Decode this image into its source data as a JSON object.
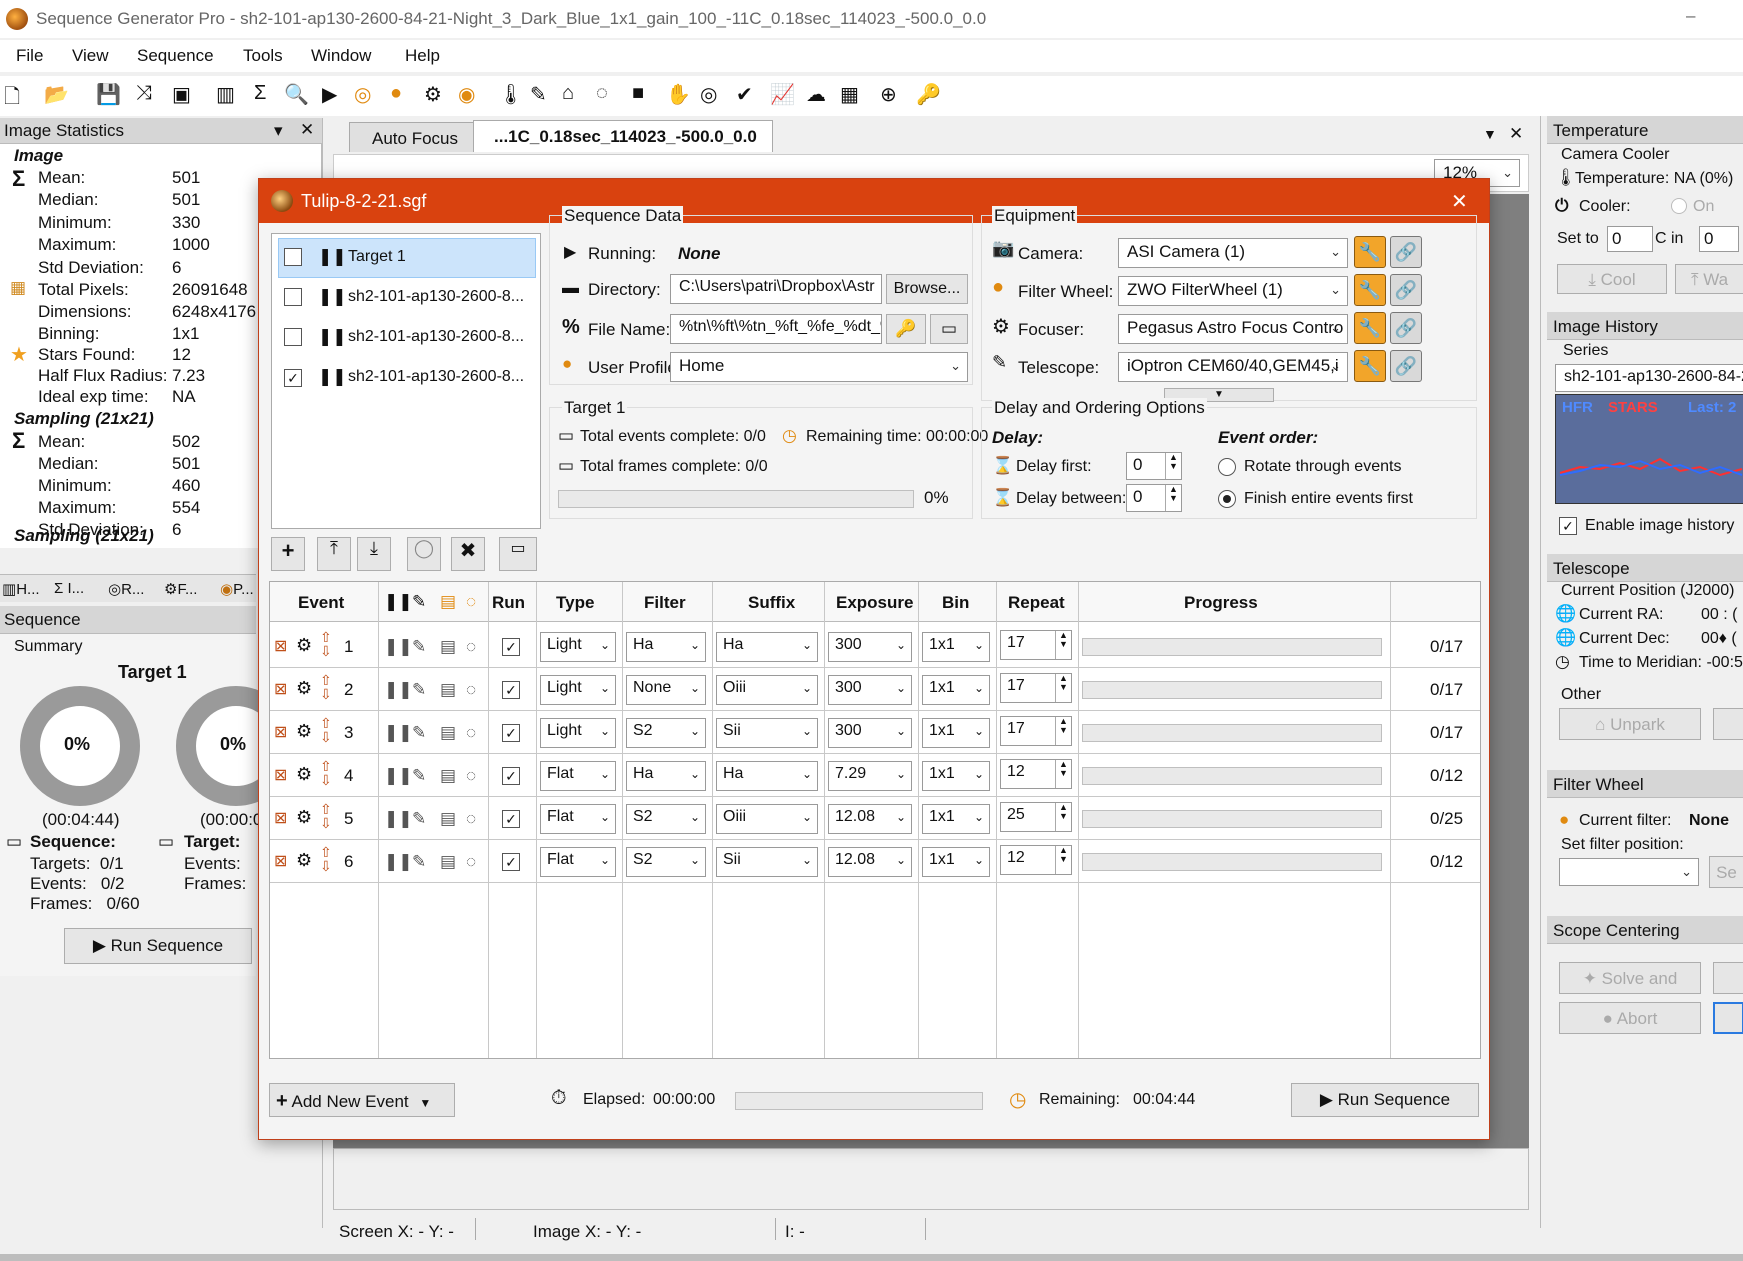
{
  "app": {
    "title": "Sequence Generator Pro - sh2-101-ap130-2600-84-21-Night_3_Dark_Blue_1x1_gain_100_-11C_0.18sec_114023_-500.0_0.0",
    "minimize": "–"
  },
  "menu": [
    "File",
    "View",
    "Sequence",
    "Tools",
    "Window",
    "Help"
  ],
  "stats": {
    "panel_title": "Image Statistics",
    "image_heading": "Image",
    "rows": [
      {
        "label": "Mean:",
        "value": "501"
      },
      {
        "label": "Median:",
        "value": "501"
      },
      {
        "label": "Minimum:",
        "value": "330"
      },
      {
        "label": "Maximum:",
        "value": "1000"
      },
      {
        "label": "Std Deviation:",
        "value": "6"
      },
      {
        "label": "Total Pixels:",
        "value": "26091648"
      },
      {
        "label": "Dimensions:",
        "value": "6248x4176"
      },
      {
        "label": "Binning:",
        "value": "1x1"
      },
      {
        "label": "Stars Found:",
        "value": "12"
      },
      {
        "label": "Half Flux Radius:",
        "value": "7.23"
      },
      {
        "label": "Ideal exp time:",
        "value": "NA"
      }
    ],
    "sampling_heading": "Sampling (21x21)",
    "sampling_rows": [
      {
        "label": "Mean:",
        "value": "502"
      },
      {
        "label": "Median:",
        "value": "501"
      },
      {
        "label": "Minimum:",
        "value": "460"
      },
      {
        "label": "Maximum:",
        "value": "554"
      },
      {
        "label": "Std Deviation:",
        "value": "6"
      }
    ],
    "tabs": [
      "H...",
      "I...",
      "R...",
      "F...",
      "P..."
    ]
  },
  "seqpanel": {
    "title": "Sequence",
    "summary": "Summary",
    "target_title": "Target 1",
    "ring1": "0%",
    "ring2": "0%",
    "time1": "(00:04:44)",
    "time2": "(00:00:0",
    "seq_label": "Sequence:",
    "target_label": "Target:",
    "targets": "Targets:  0/1",
    "events": "Events:   0/2",
    "frames": "Frames:   0/60",
    "t_events": "Events:",
    "t_frames": "Frames:",
    "run": "Run Sequence"
  },
  "doctabs": {
    "autofocus": "Auto Focus",
    "image": "...1C_0.18sec_114023_-500.0_0.0",
    "zoom": "12%"
  },
  "status": {
    "screen": "Screen X: - Y: -",
    "image": "Image X: - Y: -",
    "i": "I: -"
  },
  "dialog": {
    "title": "Tulip-8-2-21.sgf",
    "close": "✕",
    "targets": [
      {
        "name": "Target 1",
        "checked": false
      },
      {
        "name": "sh2-101-ap130-2600-8...",
        "checked": false
      },
      {
        "name": "sh2-101-ap130-2600-8...",
        "checked": false
      },
      {
        "name": "sh2-101-ap130-2600-8...",
        "checked": true
      }
    ],
    "seqdata": {
      "group": "Sequence Data",
      "running_label": "Running:",
      "running": "None",
      "dir_label": "Directory:",
      "dir": "C:\\Users\\patri\\Dropbox\\Astr",
      "browse": "Browse...",
      "file_label": "File Name:",
      "file": "%tn\\%ft\\%tn_%ft_%fe_%dt_%",
      "profile_label": "User Profile:",
      "profile": "Home"
    },
    "equipment": {
      "group": "Equipment",
      "items": [
        {
          "label": "Camera:",
          "value": "ASI Camera (1)"
        },
        {
          "label": "Filter Wheel:",
          "value": "ZWO FilterWheel (1)"
        },
        {
          "label": "Focuser:",
          "value": "Pegasus Astro Focus Contro"
        },
        {
          "label": "Telescope:",
          "value": "iOptron CEM60/40,GEM45,i"
        }
      ]
    },
    "target_info": {
      "group": "Target 1",
      "events": "Total events complete: 0/0",
      "remaining": "Remaining time: 00:00:00",
      "frames": "Total frames complete: 0/0",
      "pct": "0%",
      "progress": 0
    },
    "delay": {
      "group": "Delay and Ordering Options",
      "delay_h": "Delay:",
      "first_label": "Delay first:",
      "first": "0",
      "between_label": "Delay between:",
      "between": "0",
      "order_h": "Event order:",
      "rotate": "Rotate through events",
      "finish": "Finish entire events first"
    },
    "columns": {
      "event": "Event",
      "run": "Run",
      "type": "Type",
      "filter": "Filter",
      "suffix": "Suffix",
      "exposure": "Exposure",
      "bin": "Bin",
      "repeat": "Repeat",
      "progress": "Progress"
    },
    "events": [
      {
        "num": "1",
        "type": "Light",
        "filter": "Ha",
        "suffix": "Ha",
        "exposure": "300",
        "bin": "1x1",
        "repeat": "17",
        "progress": "0/17"
      },
      {
        "num": "2",
        "type": "Light",
        "filter": "None",
        "suffix": "Oiii",
        "exposure": "300",
        "bin": "1x1",
        "repeat": "17",
        "progress": "0/17"
      },
      {
        "num": "3",
        "type": "Light",
        "filter": "S2",
        "suffix": "Sii",
        "exposure": "300",
        "bin": "1x1",
        "repeat": "17",
        "progress": "0/17"
      },
      {
        "num": "4",
        "type": "Flat",
        "filter": "Ha",
        "suffix": "Ha",
        "exposure": "7.29",
        "bin": "1x1",
        "repeat": "12",
        "progress": "0/12"
      },
      {
        "num": "5",
        "type": "Flat",
        "filter": "S2",
        "suffix": "Oiii",
        "exposure": "12.08",
        "bin": "1x1",
        "repeat": "25",
        "progress": "0/25"
      },
      {
        "num": "6",
        "type": "Flat",
        "filter": "S2",
        "suffix": "Sii",
        "exposure": "12.08",
        "bin": "1x1",
        "repeat": "12",
        "progress": "0/12"
      }
    ],
    "footer": {
      "add": "Add New Event",
      "elapsed_label": "Elapsed:",
      "elapsed": "00:00:00",
      "remaining_label": "Remaining:",
      "remaining": "00:04:44",
      "run": "Run Sequence"
    }
  },
  "right": {
    "temp": {
      "title": "Temperature",
      "cooler_group": "Camera Cooler",
      "temp": "Temperature: NA (0%)",
      "cooler": "Cooler:",
      "on": "On",
      "setto": "Set to",
      "setval": "0",
      "cin": "C in",
      "cinval": "0",
      "cool": "Cool",
      "warm": "Wa"
    },
    "history": {
      "title": "Image History",
      "series": "Series",
      "series_val": "sh2-101-ap130-2600-84-2",
      "hfr": "HFR",
      "stars": "STARS",
      "last": "Last: 2",
      "enable": "Enable image history"
    },
    "telescope": {
      "title": "Telescope",
      "pos": "Current Position (J2000)",
      "ra": "Current RA:",
      "ra_v": "00 : (",
      "dec": "Current Dec:",
      "dec_v": "00♦ (",
      "meridian": "Time to Meridian: -00:5",
      "other": "Other",
      "unpark": "Unpark"
    },
    "filter": {
      "title": "Filter Wheel",
      "cur_label": "Current filter:",
      "cur": "None",
      "set": "Set filter position:",
      "set_btn": "Se"
    },
    "centering": {
      "title": "Scope Centering",
      "solve": "Solve and",
      "abort": "Abort"
    }
  }
}
